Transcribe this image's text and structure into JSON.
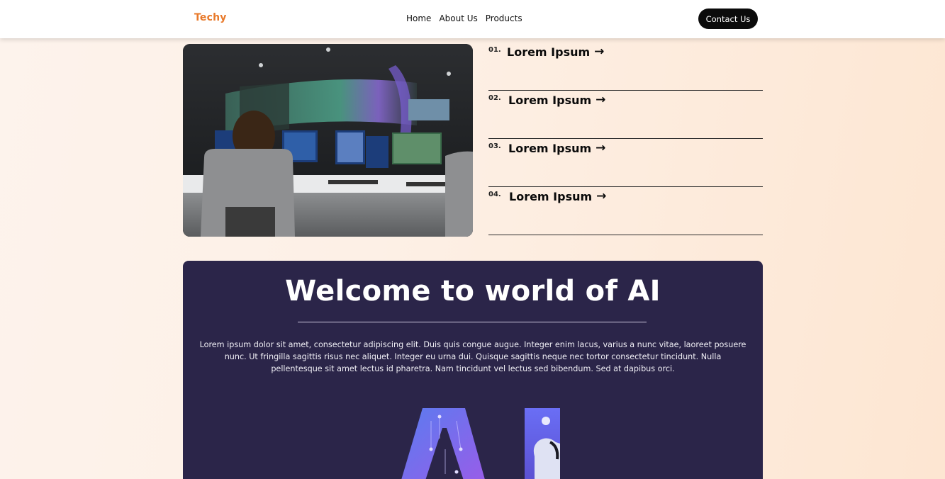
{
  "nav": {
    "brand": "Techy",
    "links": [
      "Home",
      "About Us",
      "Products"
    ],
    "cta": "Contact Us"
  },
  "hero_image": {
    "alt": "control-room-photo"
  },
  "features": [
    {
      "num": "01.",
      "title": "Lorem Ipsum",
      "icon": "arrow-right-icon"
    },
    {
      "num": "02.",
      "title": "Lorem Ipsum",
      "icon": "arrow-right-icon"
    },
    {
      "num": "03.",
      "title": "Lorem Ipsum",
      "icon": "arrow-right-icon"
    },
    {
      "num": "04.",
      "title": "Lorem Ipsum",
      "icon": "arrow-right-icon"
    }
  ],
  "welcome": {
    "title": "Welcome to world of AI",
    "body": "Lorem ipsum dolor sit amet, consectetur adipiscing elit. Duis quis congue augue. Integer enim lacus, varius a nunc vitae, laoreet posuere nunc. Ut fringilla sagittis risus nec aliquet. Integer eu urna dui. Quisque sagittis neque nec tortor consectetur tincidunt. Nulla pellentesque sit amet lectus id pharetra. Nam tincidunt vel lectus sed bibendum. Sed at dapibus orci."
  },
  "colors": {
    "brand": "#e8792a",
    "panel": "#2b2549",
    "cta_bg": "#0b0b0b",
    "ai_purple": "#7b5cf0"
  }
}
